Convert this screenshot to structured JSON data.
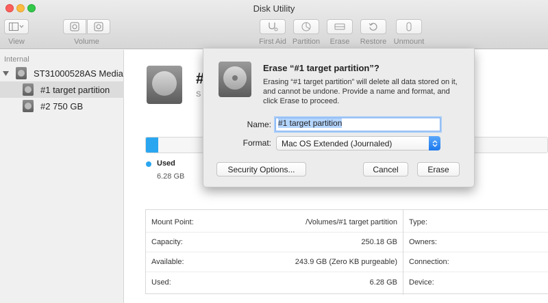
{
  "window": {
    "title": "Disk Utility"
  },
  "toolbar": {
    "view_label": "View",
    "volume_label": "Volume",
    "first_aid_label": "First Aid",
    "partition_label": "Partition",
    "erase_label": "Erase",
    "restore_label": "Restore",
    "unmount_label": "Unmount"
  },
  "sidebar": {
    "section": "Internal",
    "disk": "ST31000528AS Media",
    "items": [
      {
        "label": "#1 target partition",
        "selected": true
      },
      {
        "label": "#2 750 GB",
        "selected": false
      }
    ]
  },
  "main": {
    "title": "#",
    "subtitle": "S",
    "used_label": "Used",
    "used_value": "6.28 GB",
    "used_fraction": 0.03,
    "accent_color": "#2aa6f0",
    "info_left": [
      {
        "label": "Mount Point:",
        "value": "/Volumes/#1 target partition"
      },
      {
        "label": "Capacity:",
        "value": "250.18 GB"
      },
      {
        "label": "Available:",
        "value": "243.9 GB (Zero KB purgeable)"
      },
      {
        "label": "Used:",
        "value": "6.28 GB"
      }
    ],
    "info_right": [
      {
        "label": "Type:"
      },
      {
        "label": "Owners:"
      },
      {
        "label": "Connection:"
      },
      {
        "label": "Device:"
      }
    ]
  },
  "sheet": {
    "title": "Erase “#1 target partition”?",
    "message": "Erasing “#1 target partition” will delete all data stored on it, and cannot be undone. Provide a name and format, and click Erase to proceed.",
    "name_label": "Name:",
    "name_value": "#1 target partition",
    "format_label": "Format:",
    "format_value": "Mac OS Extended (Journaled)",
    "security_button": "Security Options...",
    "cancel_button": "Cancel",
    "erase_button": "Erase"
  }
}
